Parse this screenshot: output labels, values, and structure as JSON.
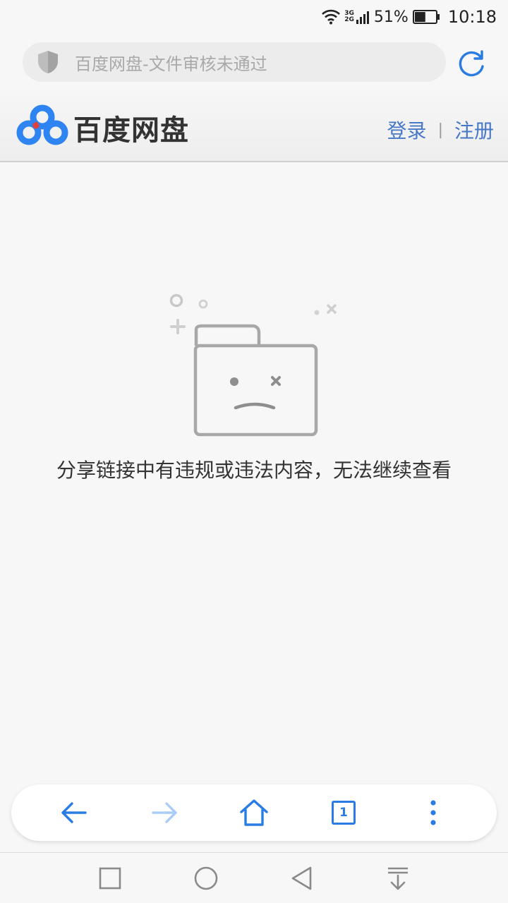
{
  "status_bar": {
    "network_top": "3G",
    "network_bottom": "2G",
    "battery_percent": "51%",
    "battery_level": 0.51,
    "time": "10:18",
    "icons": [
      "wifi-icon",
      "signal-icon",
      "battery-icon"
    ]
  },
  "address_bar": {
    "page_title": "百度网盘-文件审核未通过",
    "icons": [
      "shield-icon",
      "refresh-icon"
    ]
  },
  "site_header": {
    "logo_text": "百度网盘",
    "login": "登录",
    "separator": "|",
    "register": "注册"
  },
  "main": {
    "error_message": "分享链接中有违规或违法内容，无法继续查看"
  },
  "toolbar": {
    "tab_count": "1",
    "icons": [
      "back-arrow-icon",
      "forward-arrow-icon",
      "home-icon",
      "tabs-icon",
      "more-icon"
    ]
  },
  "nav_bar": {
    "icons": [
      "recent-apps-icon",
      "home-circle-icon",
      "back-triangle-icon",
      "notification-pull-icon"
    ]
  },
  "colors": {
    "accent": "#2a7be4",
    "link": "#4778c7",
    "logo_blue": "#2e84f0",
    "logo_red": "#e0413a"
  }
}
